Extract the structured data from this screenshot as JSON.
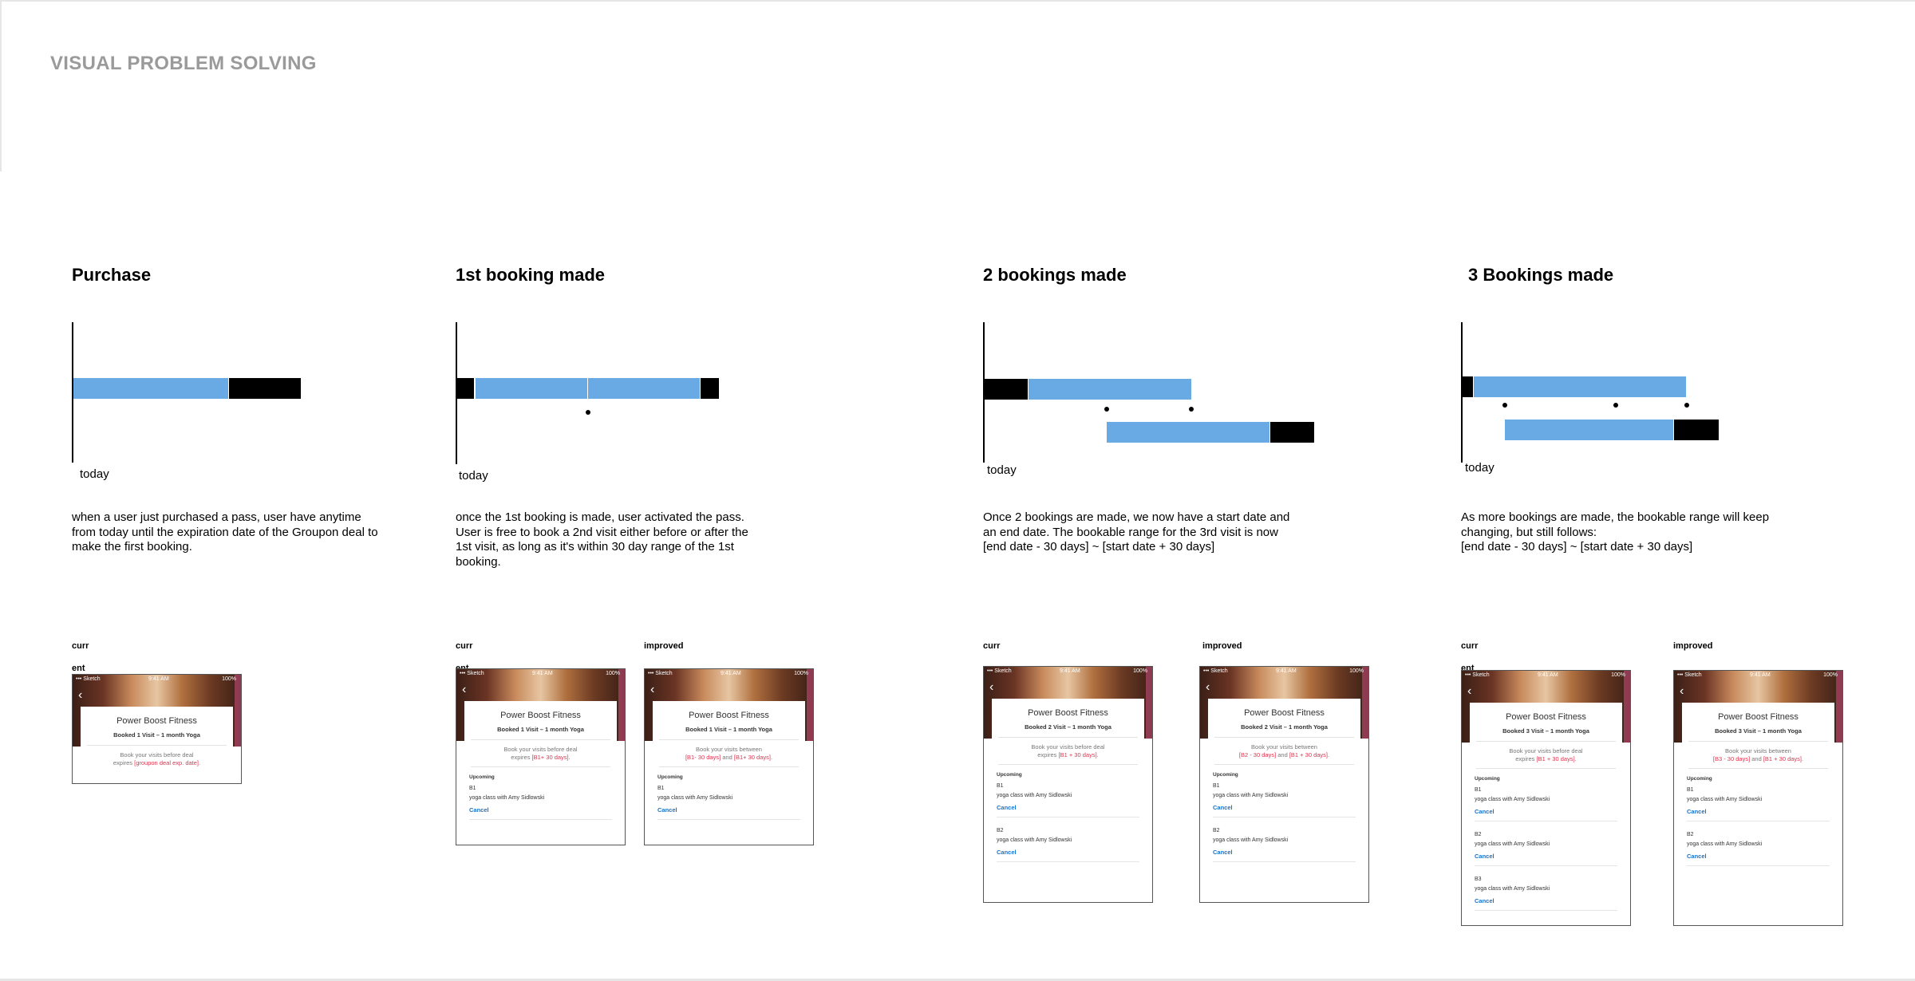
{
  "page": {
    "title": "VISUAL PROBLEM SOLVING"
  },
  "columns": [
    {
      "title": "Purchase",
      "today": "today",
      "description": "when a user just purchased a pass, user have anytime\nfrom today until the expiration date of the Groupon deal to\nmake the first booking.",
      "current_label": "curr",
      "current_label_overflow": "ent"
    },
    {
      "title": "1st booking made",
      "today": "today",
      "description": "once the 1st booking is made, user activated the pass.\nUser is free to book a 2nd visit either before or after the\n1st visit, as long as it's within 30 day range of the 1st\nbooking.",
      "current_label": "curr",
      "current_label_overflow": "ent",
      "improved_label": "improved"
    },
    {
      "title": "2 bookings made",
      "today": "today",
      "description": "Once 2 bookings are made, we now have a start date and\nan end date. The bookable range for the 3rd visit is now\n[end date - 30 days] ~ [start date + 30 days]",
      "current_label": "curr",
      "improved_label": "improved"
    },
    {
      "title": "3 Bookings made",
      "today": "today",
      "description": "As more bookings are made, the bookable range will keep\nchanging, but still follows:\n[end date - 30 days] ~ [start date + 30 days]",
      "current_label": "curr",
      "current_label_overflow": "ent",
      "improved_label": "improved"
    }
  ],
  "colors": {
    "range": "#6aaae4",
    "blocked": "#000000",
    "highlight": "#e0334e",
    "link": "#1a73c9",
    "title_gray": "#9a9a9a"
  },
  "phones": [
    {
      "status": {
        "signal": "••• Sketch",
        "time": "9:41 AM",
        "battery": "100%"
      },
      "gym": "Power Boost Fitness",
      "booked": "Booked 1 Visit – 1 month Yoga",
      "note_pre": "Book your visits before deal",
      "note_mid": "expires ",
      "note_red": "[groupon deal exp. date]",
      "note_mid2": "",
      "note_red2": "",
      "note_post": ".",
      "bookings": []
    },
    {
      "status": {
        "signal": "••• Sketch",
        "time": "9:41 AM",
        "battery": "100%"
      },
      "gym": "Power Boost Fitness",
      "booked": "Booked 1 Visit – 1 month Yoga",
      "note_pre": "Book your visits before deal",
      "note_mid": "expires ",
      "note_red": "[B1+ 30 days]",
      "note_mid2": "",
      "note_red2": "",
      "note_post": ".",
      "upcoming": "Upcoming",
      "bookings": [
        {
          "id": "B1",
          "cls": "yoga class with Amy Sidlowski",
          "cancel": "Cancel"
        }
      ]
    },
    {
      "status": {
        "signal": "••• Sketch",
        "time": "9:41 AM",
        "battery": "100%"
      },
      "gym": "Power Boost Fitness",
      "booked": "Booked 1 Visit – 1 month Yoga",
      "note_pre": "Book your visits between ",
      "note_mid": "",
      "note_red": "[B1- 30 days]",
      "note_mid2": " and ",
      "note_red2": "[B1+ 30 days]",
      "note_post": ".",
      "upcoming": "Upcoming",
      "bookings": [
        {
          "id": "B1",
          "cls": "yoga class with Amy Sidlowski",
          "cancel": "Cancel"
        }
      ]
    },
    {
      "status": {
        "signal": "••• Sketch",
        "time": "9:41 AM",
        "battery": "100%"
      },
      "gym": "Power Boost Fitness",
      "booked": "Booked 2 Visit – 1 month Yoga",
      "note_pre": "Book your visits before deal",
      "note_mid": "expires ",
      "note_red": "[B1 + 30 days]",
      "note_mid2": "",
      "note_red2": "",
      "note_post": ".",
      "upcoming": "Upcoming",
      "bookings": [
        {
          "id": "B1",
          "cls": "yoga class with Amy Sidlowski",
          "cancel": "Cancel"
        },
        {
          "id": "B2",
          "cls": "yoga class with Amy Sidlowski",
          "cancel": "Cancel"
        }
      ]
    },
    {
      "status": {
        "signal": "••• Sketch",
        "time": "9:41 AM",
        "battery": "100%"
      },
      "gym": "Power Boost Fitness",
      "booked": "Booked 2 Visit – 1 month Yoga",
      "note_pre": "Book your visits between",
      "note_mid": "",
      "note_red": "[B2 - 30 days]",
      "note_mid2": " and ",
      "note_red2": "[B1 + 30 days]",
      "note_post": ".",
      "upcoming": "Upcoming",
      "bookings": [
        {
          "id": "B1",
          "cls": "yoga class with Amy Sidlowski",
          "cancel": "Cancel"
        },
        {
          "id": "B2",
          "cls": "yoga class with Amy Sidlowski",
          "cancel": "Cancel"
        }
      ]
    },
    {
      "status": {
        "signal": "••• Sketch",
        "time": "9:41 AM",
        "battery": "100%"
      },
      "gym": "Power Boost Fitness",
      "booked": "Booked 3 Visit – 1 month Yoga",
      "note_pre": "Book your visits before deal",
      "note_mid": "expires ",
      "note_red": "[B1 + 30 days]",
      "note_mid2": "",
      "note_red2": "",
      "note_post": ".",
      "upcoming": "Upcoming",
      "bookings": [
        {
          "id": "B1",
          "cls": "yoga class with Amy Sidlowski",
          "cancel": "Cancel"
        },
        {
          "id": "B2",
          "cls": "yoga class with Amy Sidlowski",
          "cancel": "Cancel"
        },
        {
          "id": "B3",
          "cls": "yoga class with Amy Sidlowski",
          "cancel": "Cancel"
        }
      ]
    },
    {
      "status": {
        "signal": "••• Sketch",
        "time": "9:41 AM",
        "battery": "100%"
      },
      "gym": "Power Boost Fitness",
      "booked": "Booked 3 Visit – 1 month Yoga",
      "note_pre": "Book your visits between",
      "note_mid": "",
      "note_red": "[B3 - 30 days]",
      "note_mid2": " and ",
      "note_red2": "[B1 + 30 days]",
      "note_post": ".",
      "upcoming": "Upcoming",
      "bookings": [
        {
          "id": "B1",
          "cls": "yoga class with Amy Sidlowski",
          "cancel": "Cancel"
        },
        {
          "id": "B2",
          "cls": "yoga class with Amy Sidlowski",
          "cancel": "Cancel"
        }
      ]
    }
  ]
}
